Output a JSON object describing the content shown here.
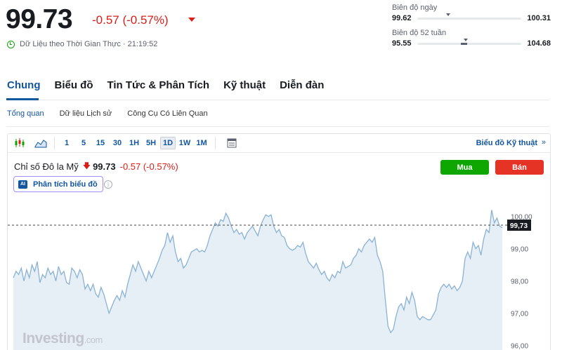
{
  "quote": {
    "price": "99.73",
    "change": "-0.57 (-0.57%)",
    "realtime_text": "Dữ Liệu theo Thời Gian Thực · 21:19:52"
  },
  "ranges": {
    "day": {
      "label": "Biên độ ngày",
      "low": "99.62",
      "high": "100.31",
      "position": 0.28
    },
    "week52": {
      "label": "Biên độ 52 tuần",
      "low": "95.55",
      "high": "104.68",
      "position": 0.45
    }
  },
  "main_tabs": [
    "Chung",
    "Biểu đồ",
    "Tin Tức & Phân Tích",
    "Kỹ thuật",
    "Diễn đàn"
  ],
  "sub_tabs": [
    "Tổng quan",
    "Dữ liệu Lịch sử",
    "Công Cụ Có Liên Quan"
  ],
  "toolbar": {
    "candle_icon": "candlestick-icon",
    "area_icon": "area-chart-icon",
    "timeframes": [
      "1",
      "5",
      "15",
      "30",
      "1H",
      "5H",
      "1D",
      "1W",
      "1M"
    ],
    "active_timeframe": "1D",
    "calendar_icon": "calendar-icon",
    "tech_link": "Biểu đồ Kỹ thuật",
    "tech_chevron": "»"
  },
  "instrument": {
    "name": "Chỉ số Đô la Mỹ",
    "arrow": "🡇",
    "price": "99.73",
    "change": "-0.57 (-0.57%)"
  },
  "buttons": {
    "buy": "Mua",
    "sell": "Bán",
    "ai": "Phân tích biểu đồ",
    "ai_badge": "AI"
  },
  "watermark": {
    "brand": "Investing",
    "suffix": ".com"
  },
  "colors": {
    "accent": "#1256a0",
    "down": "#d91e18",
    "buy": "#0ea600",
    "sell": "#e53426",
    "line": "#89b2d4",
    "fill": "#e7eff6"
  },
  "chart_data": {
    "type": "area",
    "y_ticks": [
      "100,00",
      "99,00",
      "98,00",
      "97,00",
      "96,00"
    ],
    "ylim": [
      95.6,
      100.6
    ],
    "last_price_label": "99,73",
    "last_price": 99.73,
    "values": [
      98.1,
      98.3,
      98.2,
      98.4,
      98.0,
      98.35,
      98.1,
      98.5,
      98.3,
      98.6,
      97.95,
      98.2,
      98.1,
      98.4,
      98.2,
      98.3,
      98.0,
      98.45,
      98.2,
      98.3,
      97.95,
      97.9,
      98.4,
      98.3,
      98.1,
      98.35,
      98.2,
      97.75,
      97.9,
      97.7,
      97.9,
      97.6,
      97.5,
      97.8,
      97.6,
      97.3,
      97.0,
      97.2,
      97.4,
      97.55,
      97.4,
      97.7,
      97.5,
      97.9,
      98.2,
      98.5,
      98.3,
      98.6,
      98.4,
      98.2,
      98.0,
      98.3,
      98.1,
      98.3,
      98.5,
      98.7,
      98.95,
      99.1,
      99.5,
      99.2,
      99.4,
      98.9,
      98.6,
      98.7,
      98.4,
      98.5,
      98.7,
      98.9,
      98.95,
      99.0,
      98.9,
      98.95,
      98.9,
      99.1,
      99.4,
      99.6,
      99.8,
      99.7,
      99.9,
      99.85,
      100.1,
      99.95,
      99.7,
      99.5,
      99.6,
      99.45,
      99.5,
      99.3,
      99.5,
      99.6,
      99.7,
      99.55,
      99.4,
      99.7,
      99.9,
      100.05,
      100.0,
      100.05,
      99.7,
      99.5,
      99.6,
      99.4,
      99.35,
      99.1,
      99.0,
      98.95,
      99.0,
      99.1,
      99.05,
      99.2,
      98.85,
      98.6,
      98.5,
      98.4,
      98.55,
      98.35,
      98.2,
      98.3,
      98.1,
      98.0,
      98.2,
      98.1,
      98.3,
      98.25,
      98.6,
      98.4,
      98.45,
      98.5,
      98.7,
      98.8,
      99.0,
      98.9,
      99.1,
      99.2,
      99.3,
      99.2,
      99.35,
      98.8,
      98.6,
      98.3,
      97.4,
      96.6,
      96.4,
      96.5,
      96.9,
      97.2,
      97.3,
      97.1,
      97.5,
      97.3,
      97.65,
      97.4,
      96.9,
      96.8,
      96.9,
      96.85,
      96.8,
      96.8,
      96.95,
      97.1,
      97.6,
      97.8,
      97.9,
      97.8,
      97.9,
      97.75,
      97.85,
      97.7,
      97.8,
      98.0,
      98.7,
      98.9,
      98.7,
      99.2,
      99.0,
      99.1,
      98.8,
      99.3,
      99.6,
      99.5,
      100.2,
      99.8,
      99.95,
      99.7,
      99.65
    ]
  }
}
